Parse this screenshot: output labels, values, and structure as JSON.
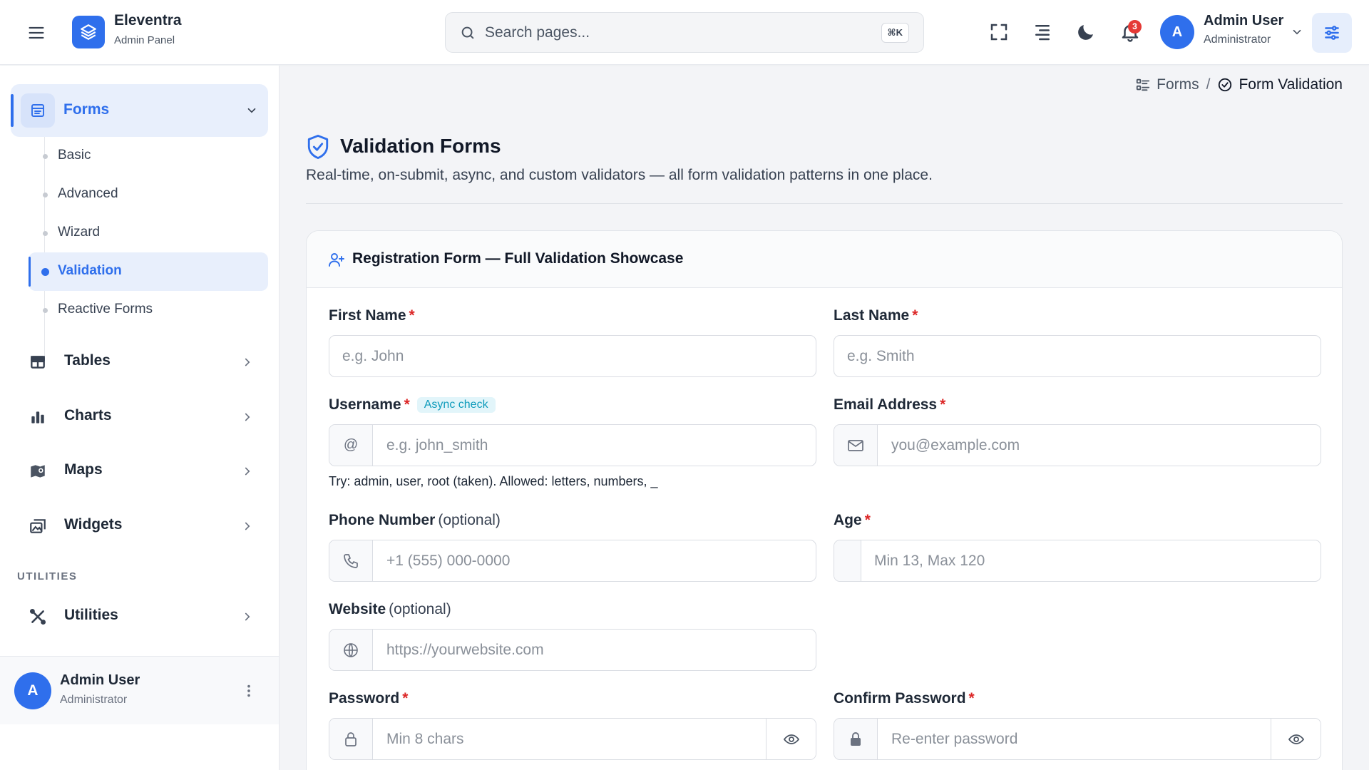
{
  "app": {
    "name": "Eleventra",
    "subtitle": "Admin Panel"
  },
  "search": {
    "placeholder": "Search pages...",
    "shortcut": "⌘K"
  },
  "header": {
    "notifications_count": "3",
    "user": {
      "initial": "A",
      "name": "Admin User",
      "role": "Administrator"
    }
  },
  "sidebar": {
    "forms_label": "Forms",
    "forms_children": [
      "Basic",
      "Advanced",
      "Wizard",
      "Validation",
      "Reactive Forms"
    ],
    "items": [
      {
        "label": "Tables",
        "icon": "table-icon"
      },
      {
        "label": "Charts",
        "icon": "bar-chart-icon"
      },
      {
        "label": "Maps",
        "icon": "map-icon"
      },
      {
        "label": "Widgets",
        "icon": "widgets-icon"
      }
    ],
    "section_utilities": "UTILITIES",
    "utilities_label": "Utilities",
    "footer": {
      "initial": "A",
      "name": "Admin User",
      "role": "Administrator"
    }
  },
  "breadcrumb": {
    "parent": "Forms",
    "separator": "/",
    "current": "Form Validation"
  },
  "page": {
    "title": "Validation Forms",
    "description": "Real-time, on-submit, async, and custom validators — all form validation patterns in one place."
  },
  "card": {
    "title": "Registration Form — Full Validation Showcase",
    "required_mark": "*",
    "fields": {
      "first_name": {
        "label": "First Name",
        "placeholder": "e.g. John"
      },
      "last_name": {
        "label": "Last Name",
        "placeholder": "e.g. Smith"
      },
      "username": {
        "label": "Username",
        "badge": "Async check",
        "prefix": "@",
        "placeholder": "e.g. john_smith",
        "hint": "Try: admin, user, root (taken). Allowed: letters, numbers, _"
      },
      "email": {
        "label": "Email Address",
        "placeholder": "you@example.com"
      },
      "phone": {
        "label": "Phone Number",
        "optional": "(optional)",
        "placeholder": "+1 (555) 000-0000"
      },
      "age": {
        "label": "Age",
        "placeholder": "Min 13, Max 120"
      },
      "website": {
        "label": "Website",
        "optional": "(optional)",
        "placeholder": "https://yourwebsite.com"
      },
      "password": {
        "label": "Password",
        "placeholder": "Min 8 chars"
      },
      "confirm_password": {
        "label": "Confirm Password",
        "placeholder": "Re-enter password"
      }
    }
  },
  "colors": {
    "accent": "#2f6fec",
    "required": "#dc2626",
    "async_badge": "#0e9bbb"
  }
}
